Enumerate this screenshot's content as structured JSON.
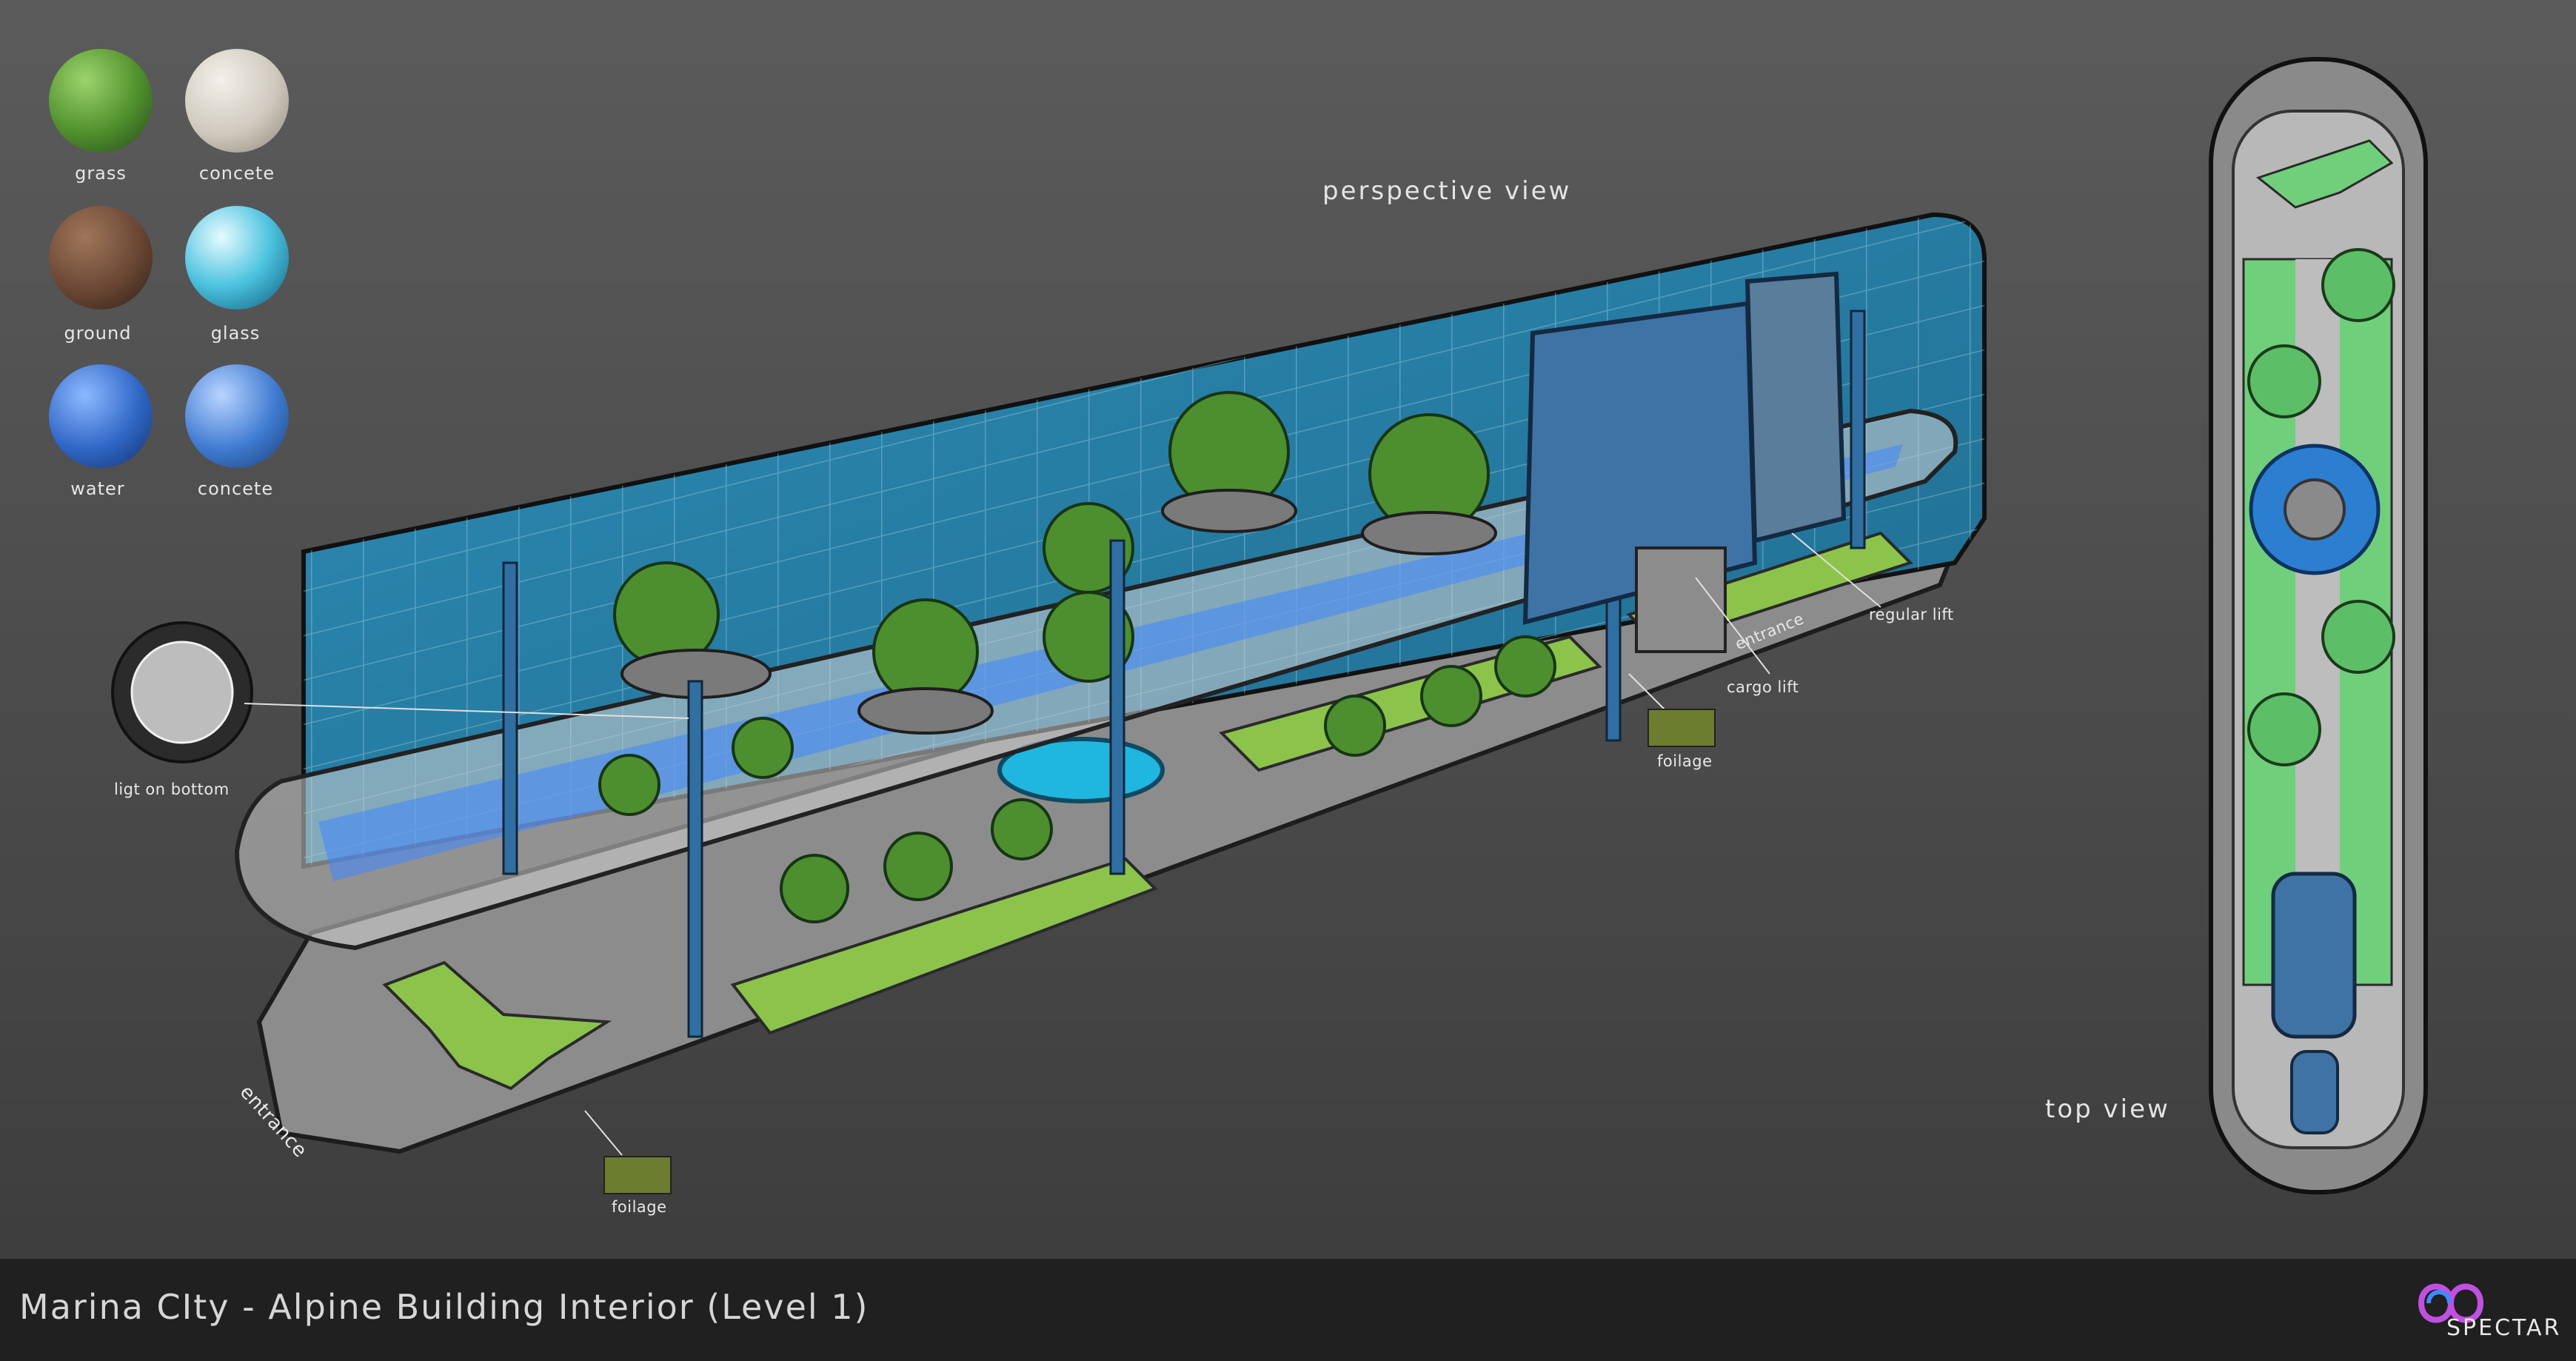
{
  "swatches": [
    {
      "label": "grass",
      "color": "#4f8f2c"
    },
    {
      "label": "concete",
      "color": "#d8d4cb"
    },
    {
      "label": "ground",
      "color": "#6a4734"
    },
    {
      "label": "glass",
      "color": "#4cc3df"
    },
    {
      "label": "water",
      "color": "#2f67c6"
    },
    {
      "label": "concete",
      "color": "#3f7bd1"
    }
  ],
  "views": {
    "perspective": "perspective view",
    "top": "top view"
  },
  "callouts": {
    "light": "ligt on bottom",
    "foliage_left": "foilage",
    "foliage_right": "foilage",
    "cargo_lift": "cargo lift",
    "regular_lift": "regular lift",
    "entrance_front": "entrance",
    "entrance_back": "entrance"
  },
  "footer": {
    "title": "Marina CIty - Alpine Building Interior (Level 1)",
    "logo_text": "SPECTAR"
  },
  "colors": {
    "glass": "#2a8fb8",
    "grass": "#8cc34a",
    "concrete": "#9a9a9a",
    "walkway": "#3f86ff",
    "lift": "#3f73a6"
  }
}
